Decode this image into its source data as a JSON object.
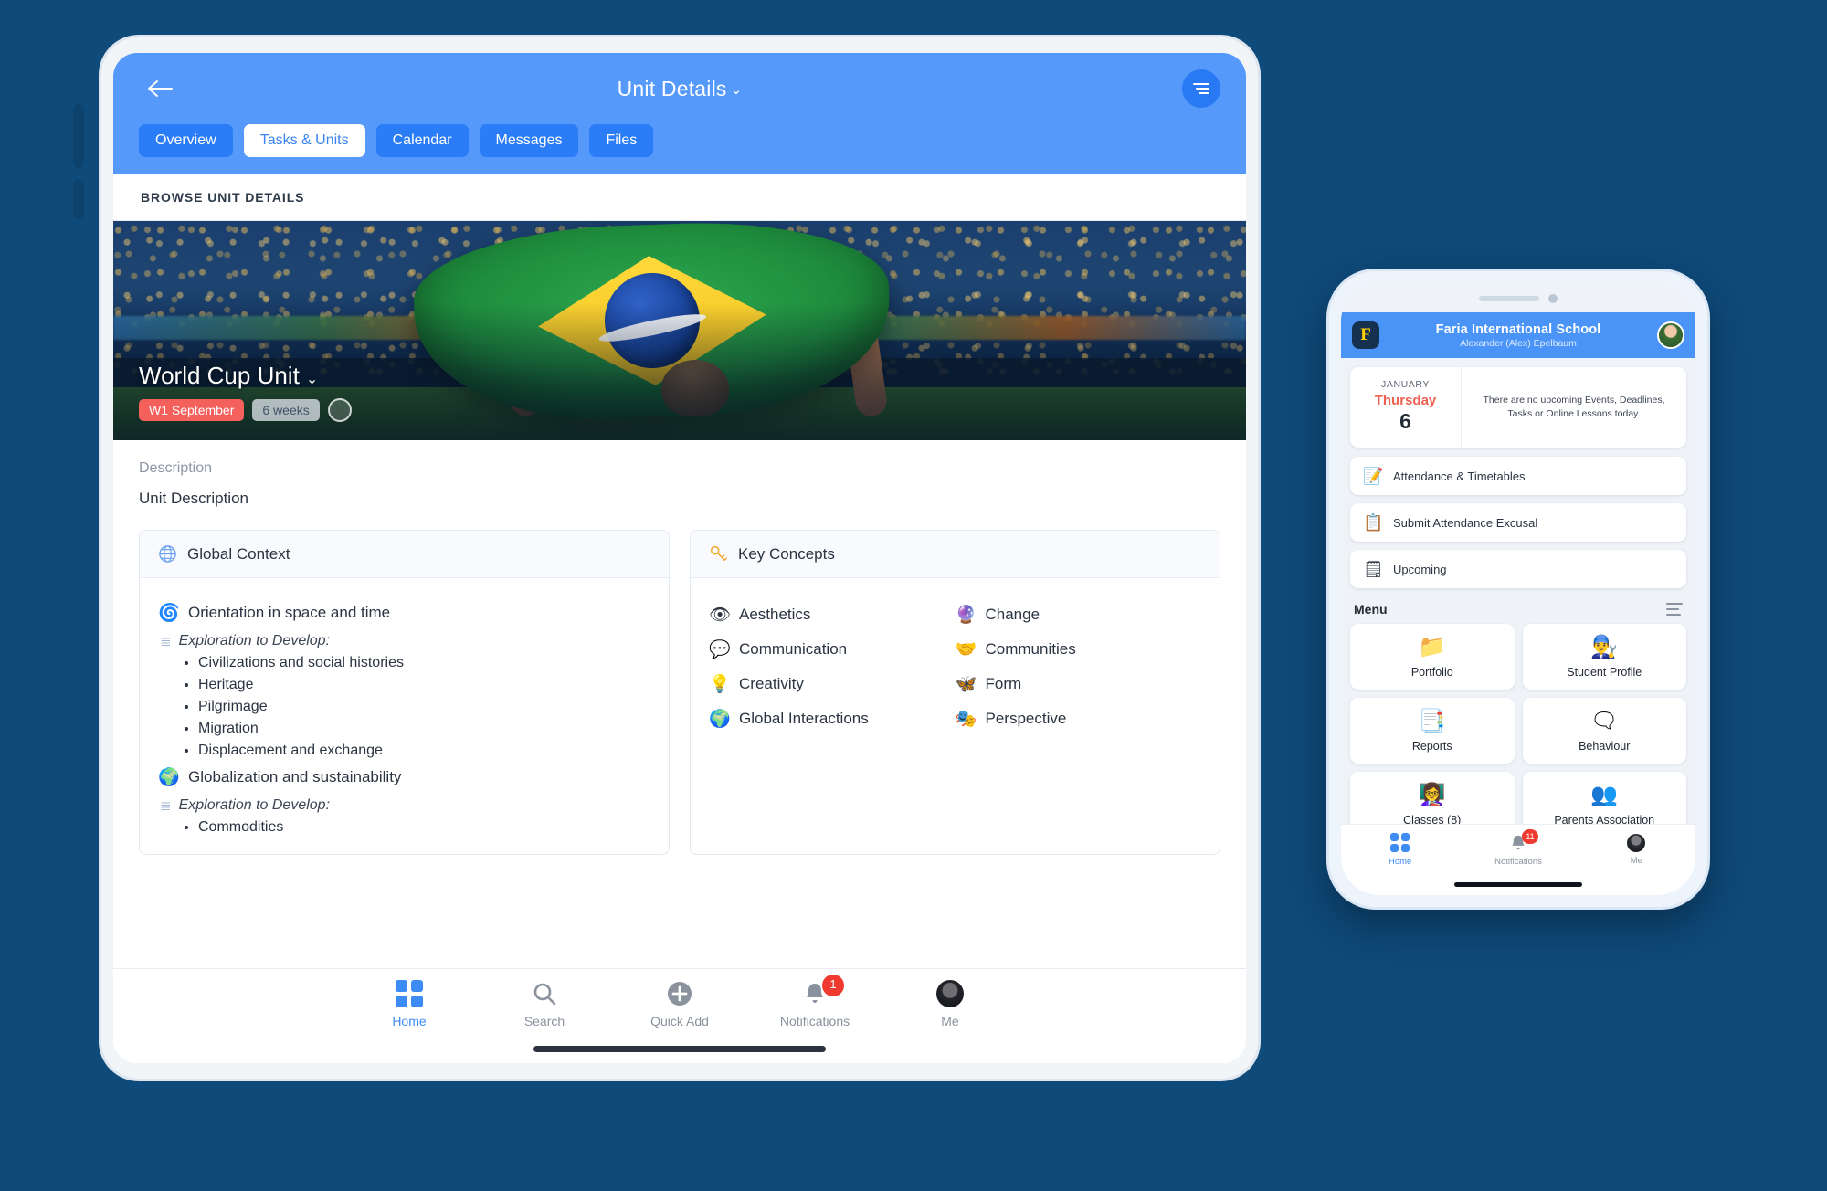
{
  "tablet": {
    "topbar": {
      "back_icon": "arrow-left-icon",
      "title": "Unit Details",
      "title_chevron": "⌄",
      "menu_icon": "hamburger-list-icon"
    },
    "tabs": [
      {
        "label": "Overview",
        "active": false
      },
      {
        "label": "Tasks & Units",
        "active": true
      },
      {
        "label": "Calendar",
        "active": false
      },
      {
        "label": "Messages",
        "active": false
      },
      {
        "label": "Files",
        "active": false
      }
    ],
    "browse_header": "BROWSE UNIT DETAILS",
    "hero": {
      "unit_title": "World Cup Unit",
      "chevron": "⌄",
      "badge_week": "W1 September",
      "badge_duration": "6 weeks"
    },
    "description": {
      "label": "Description",
      "text": "Unit Description"
    },
    "global_context": {
      "panel_title": "Global Context",
      "panel_icon": "globe-icon",
      "groups": [
        {
          "icon": "🌀",
          "title": "Orientation in space and time",
          "sub_label": "Exploration to Develop:",
          "items": [
            "Civilizations and social histories",
            "Heritage",
            "Pilgrimage",
            "Migration",
            "Displacement and exchange"
          ]
        },
        {
          "icon": "🌍",
          "title": "Globalization and sustainability",
          "sub_label": "Exploration to Develop:",
          "items": [
            "Commodities"
          ]
        }
      ]
    },
    "key_concepts": {
      "panel_title": "Key Concepts",
      "panel_icon": "key-icon",
      "column_left": [
        {
          "icon": "👁",
          "label": "Aesthetics"
        },
        {
          "icon": "💬",
          "label": "Communication"
        },
        {
          "icon": "💡",
          "label": "Creativity"
        },
        {
          "icon": "🌍",
          "label": "Global Interactions"
        }
      ],
      "column_right": [
        {
          "icon": "🔮",
          "label": "Change"
        },
        {
          "icon": "🤝",
          "label": "Communities"
        },
        {
          "icon": "🦋",
          "label": "Form"
        },
        {
          "icon": "🎭",
          "label": "Perspective"
        }
      ]
    },
    "bottom_nav": [
      {
        "label": "Home",
        "icon": "grid-icon",
        "active": true,
        "badge": ""
      },
      {
        "label": "Search",
        "icon": "search-icon",
        "active": false,
        "badge": ""
      },
      {
        "label": "Quick Add",
        "icon": "plus-circle-icon",
        "active": false,
        "badge": ""
      },
      {
        "label": "Notifications",
        "icon": "bell-icon",
        "active": false,
        "badge": "1"
      },
      {
        "label": "Me",
        "icon": "avatar-icon",
        "active": false,
        "badge": ""
      }
    ]
  },
  "phone": {
    "header": {
      "logo_letter": "F",
      "school": "Faria International School",
      "user": "Alexander (Alex) Epelbaum",
      "avatar_icon": "user-avatar"
    },
    "date_card": {
      "month": "JANUARY",
      "weekday": "Thursday",
      "day": "6",
      "message": "There are no upcoming Events, Deadlines, Tasks or Online Lessons today."
    },
    "list_items": [
      {
        "icon": "📝",
        "label": "Attendance & Timetables"
      },
      {
        "icon": "📋",
        "label": "Submit Attendance Excusal"
      },
      {
        "icon": "🗒",
        "label": "Upcoming"
      }
    ],
    "menu": {
      "title": "Menu",
      "toggle_icon": "list-view-icon",
      "tiles": [
        {
          "icon": "📁",
          "label": "Portfolio"
        },
        {
          "icon": "👨‍🔧",
          "label": "Student Profile"
        },
        {
          "icon": "📑",
          "label": "Reports"
        },
        {
          "icon": "🗨",
          "label": "Behaviour"
        },
        {
          "icon": "👩‍🏫",
          "label": "Classes (8)"
        },
        {
          "icon": "👥",
          "label": "Parents Association"
        }
      ]
    },
    "bottom_nav": [
      {
        "label": "Home",
        "icon": "grid-icon",
        "active": true,
        "badge": ""
      },
      {
        "label": "Notifications",
        "icon": "bell-icon",
        "active": false,
        "badge": "11"
      },
      {
        "label": "Me",
        "icon": "avatar-icon",
        "active": false,
        "badge": ""
      }
    ]
  },
  "colors": {
    "background": "#0e4a7a",
    "accent_blue": "#5599fb",
    "tab_blue": "#2a7cf7",
    "badge_red": "#f4605c",
    "notification_red": "#f03a30",
    "text_dark": "#2b3442",
    "text_muted": "#8d97a6"
  }
}
